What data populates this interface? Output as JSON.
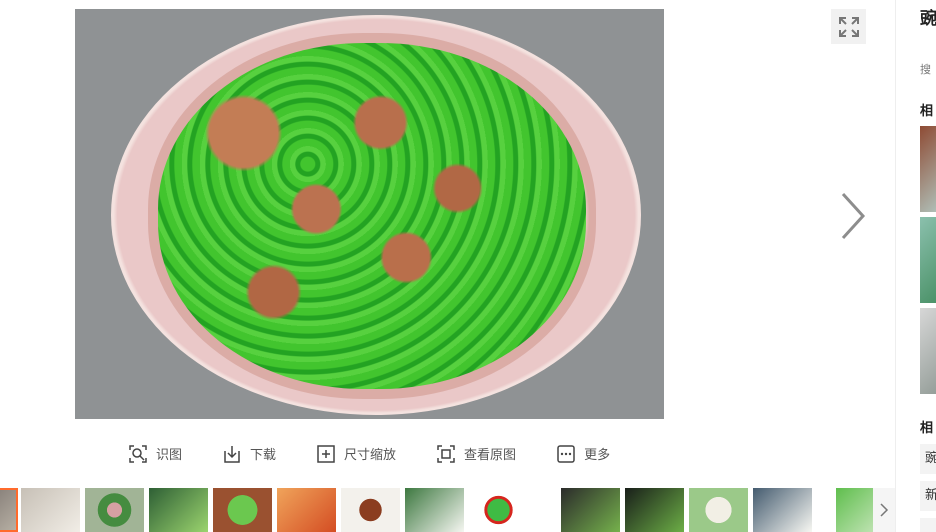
{
  "toolbar": {
    "identify": "识图",
    "download": "下载",
    "resize": "尺寸缩放",
    "original": "查看原图",
    "more": "更多"
  },
  "sidebar": {
    "title": "豌样",
    "source": "搜",
    "related_images_heading": "相",
    "related_searches_heading": "相",
    "tag_1": "豌",
    "tag_2": "新"
  },
  "icons": {
    "expand": "expand-icon",
    "next": "chevron-right-icon",
    "identify": "image-search-icon",
    "download": "download-icon",
    "resize": "plus-square-icon",
    "original": "original-size-icon",
    "more": "more-dots-icon"
  },
  "colors": {
    "accent": "#ff6b2c",
    "toolbar_text": "#555555"
  },
  "thumbnails": [
    "first-thumbnail",
    "soup-thumbnail",
    "mixed-peas-thumbnail",
    "greens-thumbnail",
    "pea-dish-thumbnail",
    "shrimp-thumbnail",
    "meat-dish-thumbnail",
    "vegetables-thumbnail",
    "pepper-thumbnail",
    "wok-thumbnail",
    "wok-greens-thumbnail",
    "tofu-thumbnail",
    "salad-thumbnail",
    "last-thumbnail"
  ]
}
